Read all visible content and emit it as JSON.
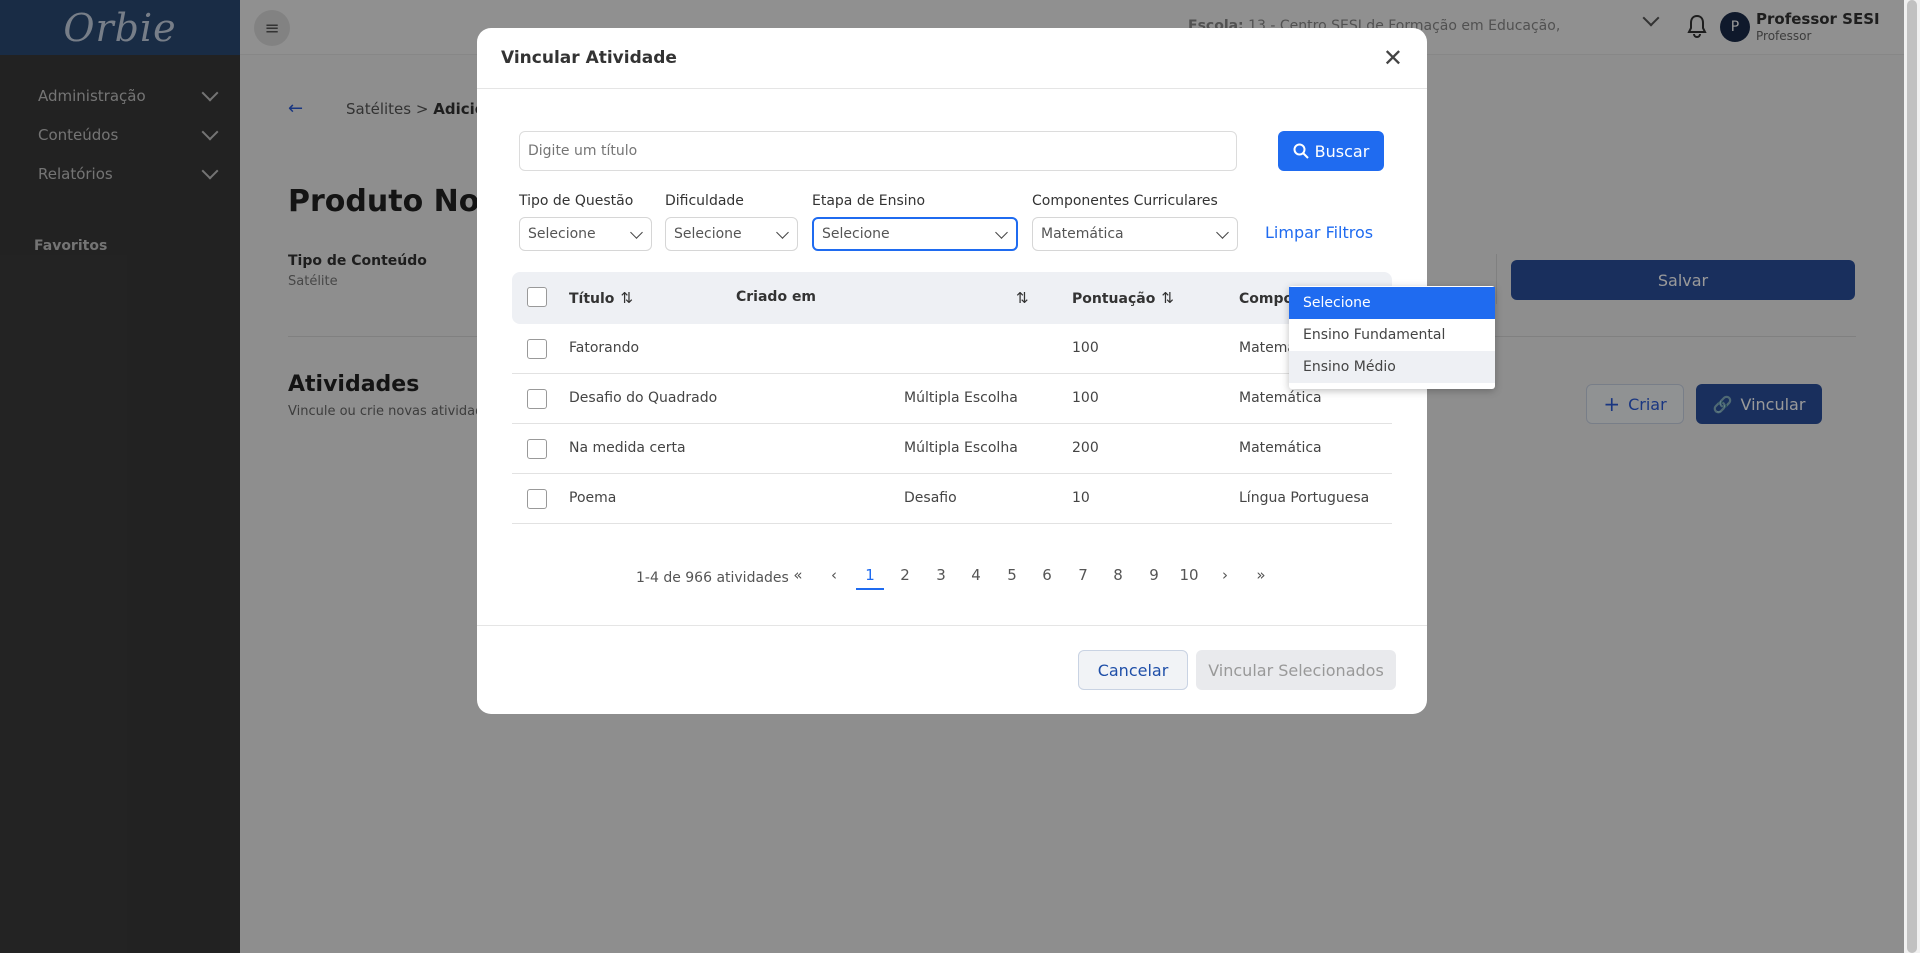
{
  "sidebar": {
    "logo": "Orbie",
    "items": [
      {
        "label": "Administração"
      },
      {
        "label": "Conteúdos"
      },
      {
        "label": "Relatórios"
      }
    ],
    "favorites_label": "Favoritos"
  },
  "header": {
    "school_label": "Escola:",
    "school_value": "13 - Centro SESI de Formação em Educação,",
    "user_initial": "P",
    "user_name": "Professor SESI",
    "user_role": "Professor"
  },
  "main": {
    "breadcrumb_root": "Satélites",
    "breadcrumb_sep": ">",
    "breadcrumb_current": "Adicionar",
    "page_title": "Produto Notáv",
    "content_type_label": "Tipo de Conteúdo",
    "content_type_value": "Satélite",
    "save_label": "Salvar",
    "activities_title": "Atividades",
    "activities_sub": "Vincule ou crie novas atividade",
    "create_label": "Criar",
    "link_label": "Vincular"
  },
  "modal": {
    "title": "Vincular Atividade",
    "search_placeholder": "Digite um título",
    "search_button": "Buscar",
    "filters": [
      {
        "label": "Tipo de Questão",
        "value": "Selecione"
      },
      {
        "label": "Dificuldade",
        "value": "Selecione"
      },
      {
        "label": "Etapa de Ensino",
        "value": "Selecione"
      },
      {
        "label": "Componentes Curriculares",
        "value": "Matemática"
      }
    ],
    "clear_filters": "Limpar Filtros",
    "columns": [
      "Título",
      "Criado em",
      "",
      "Pontuação",
      "Componente"
    ],
    "rows": [
      {
        "title": "Fatorando",
        "type": "",
        "score": "100",
        "component": "Matemática"
      },
      {
        "title": "Desafio do Quadrado",
        "type": "Múltipla Escolha",
        "score": "100",
        "component": "Matemática"
      },
      {
        "title": "Na medida certa",
        "type": "Múltipla Escolha",
        "score": "200",
        "component": "Matemática"
      },
      {
        "title": "Poema",
        "type": "Desafio",
        "score": "10",
        "component": "Língua Portuguesa"
      }
    ],
    "pagination_info": "1-4 de 966 atividades",
    "pages": [
      "1",
      "2",
      "3",
      "4",
      "5",
      "6",
      "7",
      "8",
      "9",
      "10"
    ],
    "current_page": "1",
    "cancel_label": "Cancelar",
    "link_selected_label": "Vincular Selecionados",
    "dropdown_options": [
      "Selecione",
      "Ensino Fundamental",
      "Ensino Médio"
    ]
  },
  "colors": {
    "accent": "#1f6bf0",
    "sidebar": "#3a3a3a",
    "logo_bar": "#2a4a73",
    "primary_dark": "#2a4f9c"
  },
  "icons": [
    "menu-icon",
    "chevron-down-icon",
    "bell-icon",
    "back-arrow-icon",
    "close-icon",
    "search-icon",
    "sort-icon",
    "plus-icon",
    "link-icon",
    "first-page-icon",
    "prev-page-icon",
    "next-page-icon",
    "last-page-icon"
  ]
}
